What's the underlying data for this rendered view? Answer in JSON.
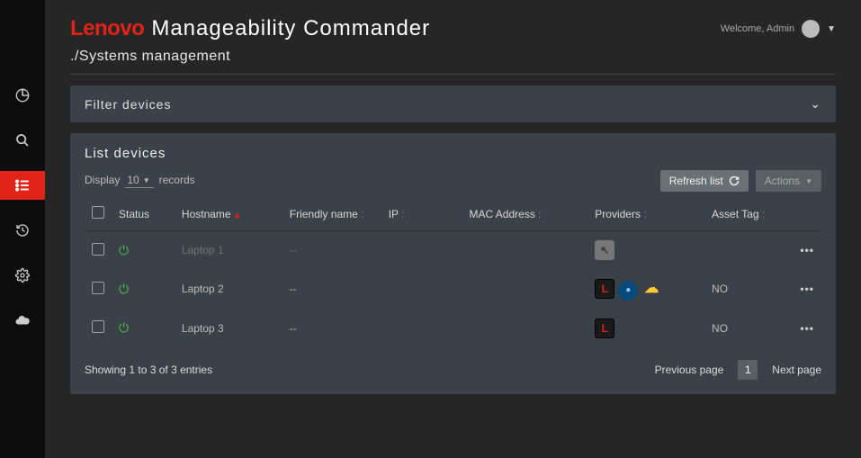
{
  "brand": {
    "lenovo": "Lenovo",
    "product": "Manageability Commander"
  },
  "user": {
    "welcome": "Welcome, Admin"
  },
  "breadcrumb": "./Systems management",
  "filter": {
    "title": "Filter devices"
  },
  "list": {
    "title": "List devices",
    "display_prefix": "Display",
    "display_count": "10",
    "display_suffix": "records",
    "refresh_label": "Refresh list",
    "actions_label": "Actions",
    "columns": {
      "status": "Status",
      "hostname": "Hostname",
      "friendly": "Friendly name",
      "ip": "IP",
      "mac": "MAC Address",
      "providers": "Providers",
      "asset": "Asset Tag"
    },
    "rows": [
      {
        "hostname": "Laptop 1",
        "friendly": "--",
        "ip": "",
        "mac": "",
        "asset": "",
        "dimmed": true,
        "providers": [
          "disabled"
        ]
      },
      {
        "hostname": "Laptop 2",
        "friendly": "--",
        "ip": "",
        "mac": "",
        "asset": "NO",
        "dimmed": false,
        "providers": [
          "L",
          "intel",
          "cloud"
        ]
      },
      {
        "hostname": "Laptop 3",
        "friendly": "--",
        "ip": "",
        "mac": "",
        "asset": "NO",
        "dimmed": false,
        "providers": [
          "L"
        ]
      }
    ],
    "showing": "Showing 1 to 3 of 3 entries",
    "prev": "Previous page",
    "page": "1",
    "next": "Next page"
  }
}
